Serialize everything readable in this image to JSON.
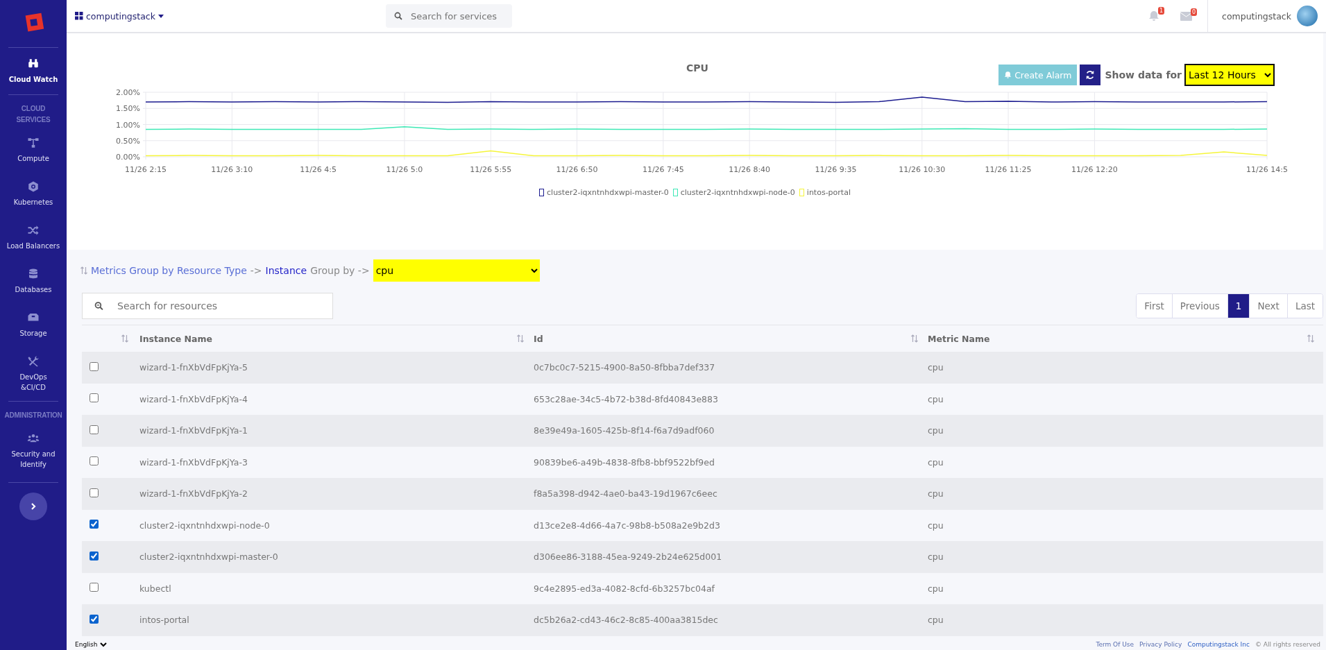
{
  "sidebar": {
    "items": [
      {
        "kind": "item",
        "label": "Cloud Watch",
        "selected": true
      },
      {
        "kind": "section",
        "label": "CLOUD SERVICES"
      },
      {
        "kind": "item",
        "label": "Compute",
        "selected": false
      },
      {
        "kind": "item",
        "label": "Kubernetes",
        "selected": false
      },
      {
        "kind": "item",
        "label": "Load Balancers",
        "selected": false
      },
      {
        "kind": "item",
        "label": "Databases",
        "selected": false
      },
      {
        "kind": "item",
        "label": "Storage",
        "selected": false
      },
      {
        "kind": "item",
        "label": "DevOps\n&CI/CD",
        "selected": false
      },
      {
        "kind": "section",
        "label": "ADMINISTRATION"
      },
      {
        "kind": "item",
        "label": "Security and\nIdentify",
        "selected": false
      }
    ]
  },
  "topbar": {
    "workspace": "computingstack",
    "search": {
      "placeholder": "Search for services"
    },
    "notifications": "1",
    "messages": "0",
    "user": "computingstack"
  },
  "chart_card": {
    "title": "CPU",
    "create_alarm": "Create Alarm",
    "show_data_for": "Show data for",
    "time_range": "Last 12 Hours",
    "chart_data": {
      "type": "line",
      "grid": true,
      "legend": "bottom",
      "ylim": [
        0,
        2
      ],
      "yticks": [
        {
          "value": 0,
          "label": "0.00%"
        },
        {
          "value": 0.5,
          "label": "0.50%"
        },
        {
          "value": 1,
          "label": "1.00%"
        },
        {
          "value": 1.5,
          "label": "1.50%"
        },
        {
          "value": 2,
          "label": "2.00%"
        }
      ],
      "categories": [
        "11/26 2:15",
        null,
        "11/26 3:10",
        null,
        "11/26 4:5",
        null,
        "11/26 5:0",
        null,
        "11/26 5:55",
        null,
        "11/26 6:50",
        null,
        "11/26 7:45",
        null,
        "11/26 8:40",
        null,
        "11/26 9:35",
        null,
        "11/26 10:30",
        null,
        "11/26 11:25",
        null,
        "11/26 12:20",
        null,
        null,
        null,
        "11/26 14:5"
      ],
      "series": [
        {
          "name": "cluster2-iqxntnhdxwpi-master-0",
          "color": "#1b1b8f",
          "values": [
            1.7,
            1.71,
            1.7,
            1.71,
            1.7,
            1.71,
            1.7,
            1.69,
            1.71,
            1.7,
            1.7,
            1.71,
            1.7,
            1.7,
            1.71,
            1.7,
            1.69,
            1.71,
            1.85,
            1.71,
            1.72,
            1.7,
            1.71,
            1.7,
            1.7,
            1.7,
            1.71
          ]
        },
        {
          "name": "cluster2-iqxntnhdxwpi-node-0",
          "color": "#3ee8b5",
          "values": [
            0.85,
            0.86,
            0.85,
            0.85,
            0.85,
            0.85,
            0.93,
            0.85,
            0.86,
            0.85,
            0.86,
            0.85,
            0.85,
            0.85,
            0.86,
            0.85,
            0.85,
            0.85,
            0.86,
            0.87,
            0.85,
            0.85,
            0.86,
            0.85,
            0.85,
            0.85,
            0.86
          ]
        },
        {
          "name": "intos-portal",
          "color": "#f5f53a",
          "values": [
            0.03,
            0.04,
            0.03,
            0.03,
            0.04,
            0.03,
            0.03,
            0.03,
            0.18,
            0.03,
            0.03,
            0.04,
            0.03,
            0.03,
            0.04,
            0.03,
            0.03,
            0.04,
            0.03,
            0.03,
            0.04,
            0.03,
            0.03,
            0.03,
            0.04,
            0.15,
            0.04
          ]
        }
      ]
    }
  },
  "group_by": {
    "path": "Metrics Group by Resource Type",
    "arrow": "->",
    "current": "Instance",
    "label": "Group by ->",
    "value": "cpu"
  },
  "resources": {
    "search": {
      "placeholder": "Search for resources"
    },
    "pagination": [
      {
        "label": "First",
        "selected": false
      },
      {
        "label": "Previous",
        "selected": false
      },
      {
        "label": "1",
        "selected": true
      },
      {
        "label": "Next",
        "selected": false
      },
      {
        "label": "Last",
        "selected": false
      }
    ],
    "columns": [
      "Instance Name",
      "Id",
      "Metric Name"
    ],
    "rows": [
      {
        "checked": false,
        "name": "wizard-1-fnXbVdFpKjYa-5",
        "id": "0c7bc0c7-5215-4900-8a50-8fbba7def337",
        "metric": "cpu"
      },
      {
        "checked": false,
        "name": "wizard-1-fnXbVdFpKjYa-4",
        "id": "653c28ae-34c5-4b72-b38d-8fd40843e883",
        "metric": "cpu"
      },
      {
        "checked": false,
        "name": "wizard-1-fnXbVdFpKjYa-1",
        "id": "8e39e49a-1605-425b-8f14-f6a7d9adf060",
        "metric": "cpu"
      },
      {
        "checked": false,
        "name": "wizard-1-fnXbVdFpKjYa-3",
        "id": "90839be6-a49b-4838-8fb8-bbf9522bf9ed",
        "metric": "cpu"
      },
      {
        "checked": false,
        "name": "wizard-1-fnXbVdFpKjYa-2",
        "id": "f8a5a398-d942-4ae0-ba43-19d1967c6eec",
        "metric": "cpu"
      },
      {
        "checked": true,
        "name": "cluster2-iqxntnhdxwpi-node-0",
        "id": "d13ce2e8-4d66-4a7c-98b8-b508a2e9b2d3",
        "metric": "cpu"
      },
      {
        "checked": true,
        "name": "cluster2-iqxntnhdxwpi-master-0",
        "id": "d306ee86-3188-45ea-9249-2b24e625d001",
        "metric": "cpu"
      },
      {
        "checked": false,
        "name": "kubectl",
        "id": "9c4e2895-ed3a-4082-8cfd-6b3257bc04af",
        "metric": "cpu"
      },
      {
        "checked": true,
        "name": "intos-portal",
        "id": "dc5b26a2-cd43-46c2-8c85-400aa3815dec",
        "metric": "cpu"
      }
    ]
  },
  "footer": {
    "language": "English",
    "links": [
      "Term Of Use",
      "Privacy Policy",
      "Computingstack Inc"
    ],
    "copyright": "© All rights reserved"
  }
}
